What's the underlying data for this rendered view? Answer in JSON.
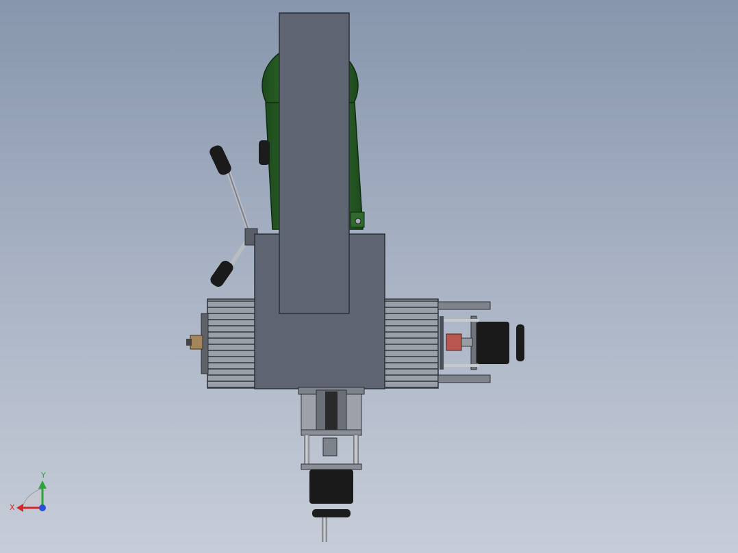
{
  "viewport": {
    "background_top": "#8796ac",
    "background_bottom": "#c7cdd8"
  },
  "model": {
    "body_color": "#2f6b2c",
    "column_color": "#5e6371",
    "steel_color": "#8e949e",
    "motor_color": "#1a1a1a"
  },
  "triad": {
    "x_label": "X",
    "y_label": "Y",
    "x_color": "#d4282b",
    "y_color": "#2aa53a",
    "z_color": "#2b4fd6"
  }
}
